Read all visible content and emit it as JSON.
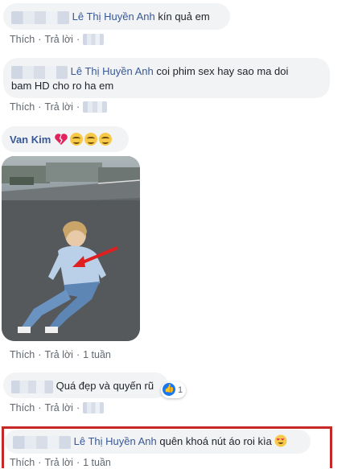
{
  "comments": [
    {
      "author_redacted": true,
      "mention": "Lê Thị Huyền Anh",
      "text": " kín quả em",
      "actions": {
        "like": "Thích",
        "reply": "Trả lời",
        "time": ""
      }
    },
    {
      "author_redacted": true,
      "mention": "Lê Thị Huyền Anh",
      "text": " coi phim sex hay sao ma doi",
      "text_line2": "bam HD cho ro ha em",
      "actions": {
        "like": "Thích",
        "reply": "Trả lời",
        "time": ""
      }
    },
    {
      "author": "Van Kim",
      "emoji": [
        "heart-break-icon",
        "smile-icon",
        "smile-icon",
        "smile-icon"
      ],
      "actions": {
        "like": "Thích",
        "reply": "Trả lời",
        "time": "1 tuần"
      }
    },
    {
      "author_redacted": true,
      "text": "Quá đẹp và quyến rũ",
      "likes": "1",
      "actions": {
        "like": "Thích",
        "reply": "Trả lời",
        "time": ""
      }
    },
    {
      "author_redacted": true,
      "mention": "Lê Thị Huyền Anh",
      "text": " quên khoá nút áo roi kìa",
      "emoji": "heart-eyes-icon",
      "actions": {
        "like": "Thích",
        "reply": "Trả lời",
        "time": "1 tuần"
      }
    }
  ],
  "colors": {
    "mention": "#385898",
    "bubble": "#f2f3f5",
    "highlight": "#c62828",
    "meta": "#606770"
  }
}
